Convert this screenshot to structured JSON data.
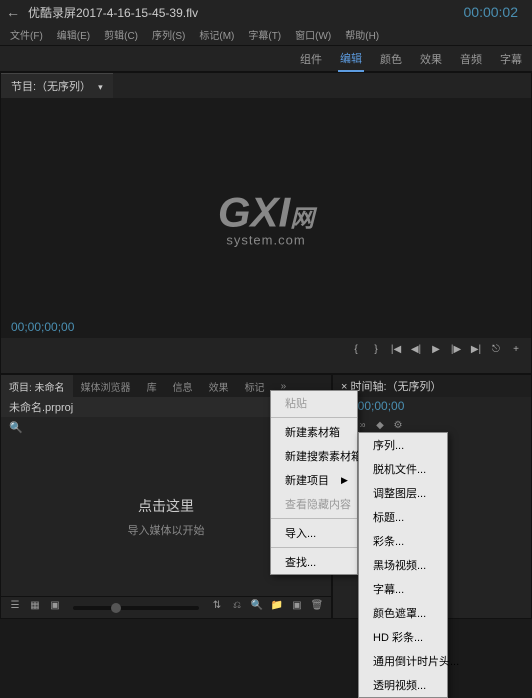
{
  "titlebar": {
    "filename": "优酷录屏2017-4-16-15-45-39.flv",
    "timecode": "00:00:02"
  },
  "menubar": {
    "items": [
      "文件(F)",
      "编辑(E)",
      "剪辑(C)",
      "序列(S)",
      "标记(M)",
      "字幕(T)",
      "窗口(W)",
      "帮助(H)"
    ]
  },
  "workspace": {
    "tabs": [
      "组件",
      "编辑",
      "颜色",
      "效果",
      "音频",
      "字幕"
    ],
    "active_index": 1
  },
  "program_panel": {
    "tab_label": "节目:（无序列）",
    "timecode": "00;00;00;00",
    "watermark_main": "GXI",
    "watermark_sub": "system.com",
    "watermark_suffix": "网"
  },
  "project_panel": {
    "tabs": [
      "项目: 未命名",
      "媒体浏览器",
      "库",
      "信息",
      "效果",
      "标记"
    ],
    "active_index": 0,
    "project_file": "未命名.prproj",
    "click_here": "点击这里",
    "import_hint": "导入媒体以开始"
  },
  "timeline": {
    "title": "× 时间轴:（无序列）",
    "timecode": "00;00;00;00"
  },
  "context_menu_1": {
    "items": [
      {
        "label": "粘贴",
        "disabled": true
      },
      {
        "sep": true
      },
      {
        "label": "新建素材箱"
      },
      {
        "label": "新建搜索素材箱"
      },
      {
        "label": "新建项目",
        "submenu": true
      },
      {
        "label": "查看隐藏内容",
        "disabled": true
      },
      {
        "sep": true
      },
      {
        "label": "导入..."
      },
      {
        "sep": true
      },
      {
        "label": "查找..."
      }
    ]
  },
  "context_menu_2": {
    "items": [
      {
        "label": "序列..."
      },
      {
        "label": "脱机文件..."
      },
      {
        "label": "调整图层..."
      },
      {
        "label": "标题..."
      },
      {
        "label": "彩条..."
      },
      {
        "label": "黑场视频..."
      },
      {
        "label": "字幕..."
      },
      {
        "label": "颜色遮罩..."
      },
      {
        "label": "HD 彩条..."
      },
      {
        "label": "通用倒计时片头..."
      },
      {
        "label": "透明视频..."
      }
    ]
  }
}
